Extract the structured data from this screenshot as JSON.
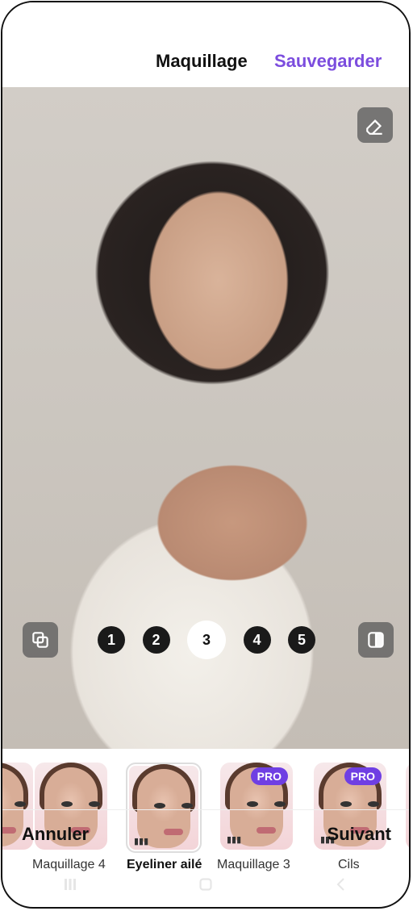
{
  "header": {
    "title": "Maquillage",
    "save_label": "Sauvegarder"
  },
  "photo": {
    "controls": {
      "eraser_icon": "eraser-icon",
      "layers_icon": "layers-icon",
      "compare_icon": "compare-icon"
    },
    "steps": [
      "1",
      "2",
      "3",
      "4",
      "5"
    ],
    "active_step": "3"
  },
  "styles": {
    "items": [
      {
        "label": "Maquillage 4",
        "pro": false,
        "selected": false
      },
      {
        "label": "Eyeliner ailé",
        "pro": false,
        "selected": true
      },
      {
        "label": "Maquillage 3",
        "pro": true,
        "pro_label": "PRO",
        "selected": false
      },
      {
        "label": "Cils",
        "pro": true,
        "pro_label": "PRO",
        "selected": false
      }
    ]
  },
  "footer": {
    "cancel_label": "Annuler",
    "next_label": "Suivant"
  },
  "colors": {
    "accent": "#7c4dde",
    "pro_badge": "#6f3fe3"
  }
}
